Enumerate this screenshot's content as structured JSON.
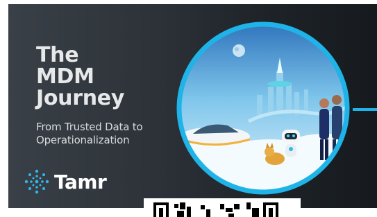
{
  "slide": {
    "title_lines": [
      "The",
      "MDM",
      "Journey"
    ],
    "subtitle_lines": [
      "From Trusted Data to",
      "Operationalization"
    ],
    "logo_text": "Tamr"
  },
  "colors": {
    "accent_ring": "#1fb3e8",
    "background_dark": "#1e2328",
    "title_text": "#e6e8ea",
    "logo_dots": "#2fb8ec"
  },
  "icons": {
    "logo": "tamr-dots-icon",
    "illustration": "futuristic-city-illustration",
    "qr": "qr-code"
  }
}
